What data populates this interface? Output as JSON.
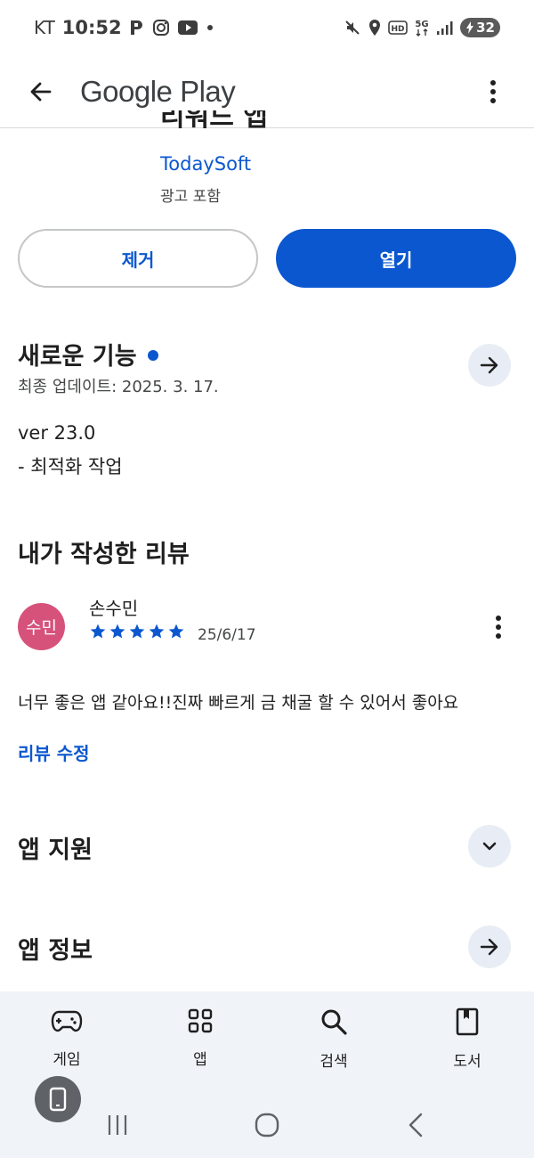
{
  "status_bar": {
    "carrier": "KT",
    "time": "10:52",
    "battery": "32"
  },
  "app_bar": {
    "title": "Google Play"
  },
  "app_header": {
    "title_partial": "리워드 앱",
    "developer": "TodaySoft",
    "ads_label": "광고 포함"
  },
  "actions": {
    "uninstall_label": "제거",
    "open_label": "열기"
  },
  "whats_new": {
    "title": "새로운 기능",
    "updated": "최종 업데이트: 2025. 3. 17.",
    "version": "ver 23.0",
    "note": "- 최적화 작업"
  },
  "my_review": {
    "title": "내가 작성한 리뷰",
    "avatar_text": "수민",
    "reviewer": "손수민",
    "rating": 5,
    "date": "25/6/17",
    "text": "너무 좋은 앱 같아요!!진짜 빠르게 금 채굴 할 수 있어서 좋아요",
    "edit_label": "리뷰 수정"
  },
  "app_support": {
    "title": "앱 지원"
  },
  "app_info": {
    "title": "앱 정보"
  },
  "bottom_nav": {
    "items": [
      {
        "label": "게임",
        "icon": "gamepad-icon"
      },
      {
        "label": "앱",
        "icon": "apps-grid-icon"
      },
      {
        "label": "검색",
        "icon": "search-icon"
      },
      {
        "label": "도서",
        "icon": "book-icon"
      }
    ]
  },
  "colors": {
    "accent": "#0b57d0",
    "avatar": "#d6527a",
    "nav_bg": "#f0f4f9",
    "circle_btn": "#e8edf5"
  }
}
